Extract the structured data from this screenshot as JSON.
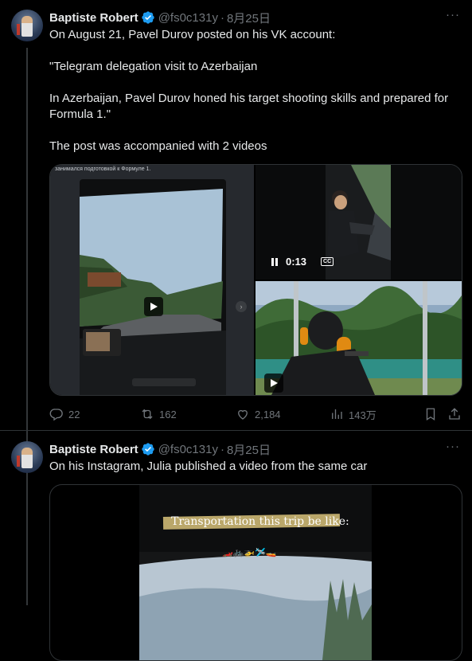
{
  "tweets": [
    {
      "author": "Baptiste Robert",
      "handle": "@fs0c131y",
      "date": "8月25日",
      "text_lines": [
        "On August 21, Pavel Durov posted on his VK account:",
        "",
        "\"Telegram delegation visit to Azerbaijan",
        "",
        "In Azerbaijan, Pavel Durov honed his target shooting skills and prepared for Formula 1.\"",
        "",
        "The post was accompanied with 2 videos"
      ],
      "media": {
        "left_caption": "занимался подготовкой к Формуле 1.",
        "video_time": "0:13",
        "cc": "CC"
      },
      "stats": {
        "replies": "22",
        "reposts": "162",
        "likes": "2,184",
        "views": "143万"
      }
    },
    {
      "author": "Baptiste Robert",
      "handle": "@fs0c131y",
      "date": "8月25日",
      "text_lines": [
        "On his Instagram, Julia published a video from the same car"
      ],
      "media": {
        "overlay_text": "Transportation this trip be like:",
        "emoji_row": "🏎️🚲🚁🛩️🚤"
      }
    }
  ],
  "colors": {
    "accent": "#1d9bf0",
    "muted": "#71767b",
    "text": "#e7e9ea",
    "border": "#2f3336"
  }
}
